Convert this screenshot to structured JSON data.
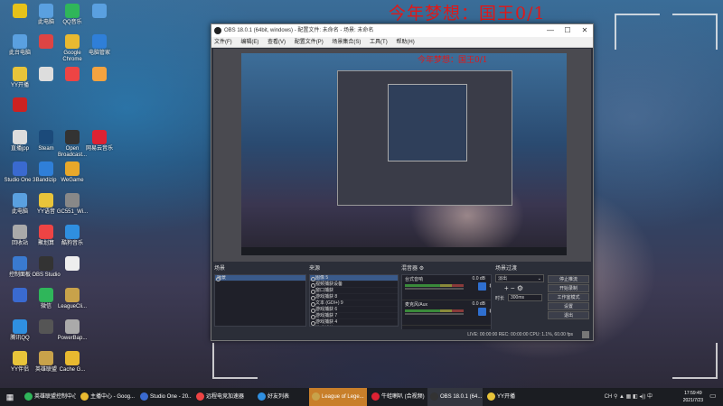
{
  "wallpaper": {
    "title": "今年梦想：国王0/1"
  },
  "desktop_icons": [
    {
      "label": "",
      "color": "#e6c21a"
    },
    {
      "label": "此电脑",
      "color": "#5aa0e0"
    },
    {
      "label": "QQ音乐",
      "color": "#2fb65a"
    },
    {
      "label": "",
      "color": "#5aa0e0"
    },
    {
      "label": "此台电脑",
      "color": "#5aa0e0"
    },
    {
      "label": "",
      "color": "#dd4444"
    },
    {
      "label": "Google Chrome",
      "color": "#e8b930"
    },
    {
      "label": "电脑管家",
      "color": "#2f7fd8"
    },
    {
      "label": "YY开播",
      "color": "#e8c43a"
    },
    {
      "label": "",
      "color": "#ddd"
    },
    {
      "label": "",
      "color": "#e44"
    },
    {
      "label": "",
      "color": "#f4a340"
    },
    {
      "label": "",
      "color": "#c22"
    },
    {
      "label": "直播jpp",
      "color": "#ddd"
    },
    {
      "label": "Steam",
      "color": "#1b4a7a"
    },
    {
      "label": "Open Broadcast...",
      "color": "#333"
    },
    {
      "label": "网易云音乐",
      "color": "#d23"
    },
    {
      "label": "Studio One 3",
      "color": "#3a6ad0"
    },
    {
      "label": "Bandizip",
      "color": "#2f7fd8"
    },
    {
      "label": "WeGame",
      "color": "#e8a82a"
    },
    {
      "label": "此电脑",
      "color": "#5aa0e0"
    },
    {
      "label": "YY语音",
      "color": "#e8c43a"
    },
    {
      "label": "GC551_Wi...",
      "color": "#888"
    },
    {
      "label": "回收站",
      "color": "#aaa"
    },
    {
      "label": "聚划算",
      "color": "#e44"
    },
    {
      "label": "酷狗音乐",
      "color": "#2f8fe0"
    },
    {
      "label": "控制面板",
      "color": "#3a7ad0"
    },
    {
      "label": "OBS Studio",
      "color": "#333"
    },
    {
      "label": "",
      "color": "#eee"
    },
    {
      "label": "",
      "color": "#3a6ad0"
    },
    {
      "label": "微信",
      "color": "#2fb65a"
    },
    {
      "label": "LeagueCli...",
      "color": "#c8a24a"
    },
    {
      "label": "腾讯QQ",
      "color": "#2f8fe0"
    },
    {
      "label": "",
      "color": "#555"
    },
    {
      "label": "PowerBap...",
      "color": "#aaa"
    },
    {
      "label": "YY伴侣",
      "color": "#e8c43a"
    },
    {
      "label": "英雄联盟",
      "color": "#c8a24a"
    },
    {
      "label": "Cache G...",
      "color": "#e8b930"
    }
  ],
  "obs": {
    "title": "OBS 18.0.1 (64bit, windows) - 配置文件: 未命名 - 场景: 未命名",
    "menu": [
      "文件(F)",
      "编辑(E)",
      "查看(V)",
      "配置文件(P)",
      "场景集合(S)",
      "工具(T)",
      "帮助(H)"
    ],
    "window_controls": [
      "—",
      "☐",
      "✕"
    ],
    "preview_title": "今年梦想：国王0/1",
    "docks": {
      "scenes": {
        "title": "场景",
        "items": [
          "场景"
        ]
      },
      "sources": {
        "title": "来源",
        "items": [
          "图像 5",
          "视频捕获设备",
          "窗口捕获",
          "游戏捕获 8",
          "文本 (GDI+) 9",
          "游戏捕获 6",
          "游戏捕获 7",
          "游戏捕获 4",
          "游戏捕获 5"
        ]
      },
      "mixer": {
        "title": "混音器",
        "channels": [
          {
            "name": "台式音响",
            "db": "0.0 dB"
          },
          {
            "name": "麦克风/Aux",
            "db": "0.0 dB"
          }
        ]
      },
      "transitions": {
        "title": "场景过渡",
        "selected": "淡出",
        "duration_label": "时长",
        "duration": "300ms"
      },
      "controls": {
        "buttons": [
          "停止推流",
          "开始录制",
          "工作室模式",
          "设置",
          "退出"
        ]
      }
    },
    "status": "LIVE: 00:00:00    REC: 00:00:00    CPU: 1.1%, 60.00 fps"
  },
  "taskbar": {
    "items": [
      {
        "label": "英雄联盟控制中心",
        "color": "#2fb65a",
        "active": false
      },
      {
        "label": "主播中心 - Goog...",
        "color": "#e8b930",
        "active": false
      },
      {
        "label": "Studio One - 20...",
        "color": "#3a6ad0",
        "active": false
      },
      {
        "label": "远程电竞加速器",
        "color": "#e44",
        "active": false
      },
      {
        "label": "好友列表",
        "color": "#2f8fe0",
        "active": false
      },
      {
        "label": "League of Lege...",
        "color": "#c8a24a",
        "active": "hl"
      },
      {
        "label": "牛蛙喇叭 (合视频)",
        "color": "#d23",
        "active": false
      },
      {
        "label": "OBS 18.0.1 (64...",
        "color": "#333",
        "active": true
      },
      {
        "label": "YY开播",
        "color": "#e8c43a",
        "active": false
      }
    ],
    "tray": "CH  ⚲  ▲  ▦  ◧  ◂))  中",
    "time": "17:59:49",
    "date": "2021/7/23"
  }
}
